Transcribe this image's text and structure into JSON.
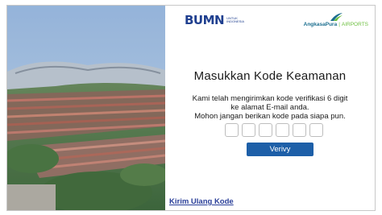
{
  "logos": {
    "bumn": {
      "word": "BUMN",
      "subtitle": "UNTUK INDONESIA"
    },
    "angkasa_pura": {
      "name": "AngkasaPura",
      "subtitle": "AIRPORTS"
    }
  },
  "verification": {
    "title": "Masukkan Kode Keamanan",
    "line1": "Kami telah mengirimkan kode verifikasi 6 digit",
    "line2": "ke alamat E-mail anda.",
    "line3": "Mohon jangan berikan kode pada siapa pun.",
    "code_digits": [
      "",
      "",
      "",
      "",
      "",
      ""
    ],
    "verify_label": "Verivy",
    "resend_label": "Kirim Ulang Kode"
  },
  "colors": {
    "primary_button": "#1d5fa8",
    "link": "#2a3f99",
    "brand_blue": "#1f3f8f",
    "brand_green": "#6cbf3f"
  }
}
